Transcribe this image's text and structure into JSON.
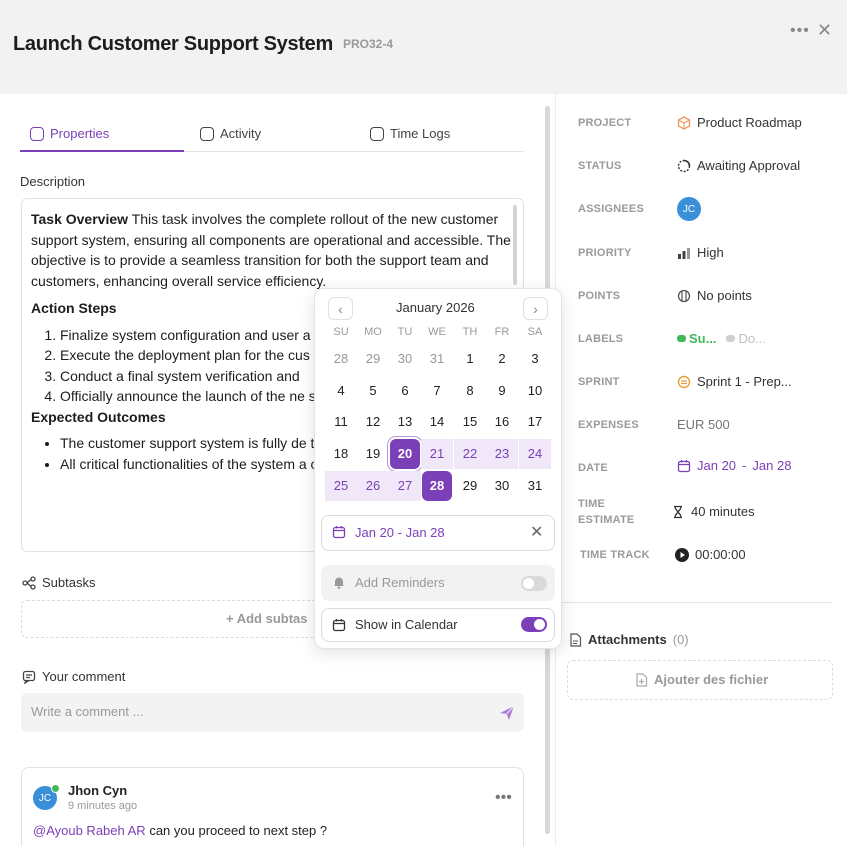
{
  "header": {
    "title": "Launch Customer Support System",
    "code": "PRO32-4",
    "more_icon": "ellipsis-icon",
    "close_icon": "close-icon"
  },
  "tabs": [
    {
      "label": "Properties",
      "active": true
    },
    {
      "label": "Activity",
      "active": false
    },
    {
      "label": "Time Logs",
      "active": false
    }
  ],
  "description": {
    "label": "Description",
    "overview_title": "Task Overview",
    "overview_text": " This task involves the complete rollout of the new customer support system, ensuring all components are operational and accessible. The objective is to provide a seamless transition for both the support team and customers, enhancing overall service efficiency.",
    "action_steps_title": "Action Steps",
    "action_steps": [
      "Finalize system configuration and user a",
      "Execute the deployment plan for the cus",
      "Conduct a final system verification and",
      "Officially announce the launch of the ne stakeholders."
    ],
    "outcomes_title": "Expected Outcomes",
    "outcomes": [
      "The customer support system is fully de to users.",
      "All critical functionalities of the system a operational"
    ]
  },
  "subtasks": {
    "label": "Subtasks",
    "add_label": "+ Add subtas"
  },
  "comment": {
    "label": "Your comment",
    "placeholder": "Write a comment ..."
  },
  "comments": [
    {
      "author": "Jhon Cyn",
      "initials": "JC",
      "time": "9 minutes ago",
      "mention": "@Ayoub Rabeh AR",
      "text": " can you proceed to next step ?"
    }
  ],
  "properties": {
    "project": {
      "label": "PROJECT",
      "value": "Product Roadmap"
    },
    "status": {
      "label": "STATUS",
      "value": "Awaiting Approval"
    },
    "assignees": {
      "label": "ASSIGNEES",
      "initials": "JC"
    },
    "priority": {
      "label": "PRIORITY",
      "value": "High"
    },
    "points": {
      "label": "POINTS",
      "value": "No points"
    },
    "labels": {
      "label": "LABELS",
      "items": [
        "Su...",
        "Do..."
      ],
      "colors": [
        "#43b75a",
        "#c8c8c8"
      ]
    },
    "sprint": {
      "label": "SPRINT",
      "value": "Sprint 1 - Prep..."
    },
    "expenses": {
      "label": "EXPENSES",
      "value": "EUR 500"
    },
    "date": {
      "label": "DATE",
      "start": "Jan 20",
      "sep": "-",
      "end": "Jan 28"
    },
    "time_estimate": {
      "label": "TIME ESTIMATE",
      "value": "40 minutes"
    },
    "time_track": {
      "label": "TIME TRACK",
      "value": "00:00:00"
    }
  },
  "attachments": {
    "label": "Attachments",
    "count": "(0)",
    "add_label": "Ajouter des fichier"
  },
  "calendar": {
    "month": "January 2026",
    "weekdays": [
      "SU",
      "MO",
      "TU",
      "WE",
      "TH",
      "FR",
      "SA"
    ],
    "weeks": [
      [
        "28",
        "29",
        "30",
        "31",
        "1",
        "2",
        "3"
      ],
      [
        "4",
        "5",
        "6",
        "7",
        "8",
        "9",
        "10"
      ],
      [
        "11",
        "12",
        "13",
        "14",
        "15",
        "16",
        "17"
      ],
      [
        "18",
        "19",
        "20",
        "21",
        "22",
        "23",
        "24"
      ],
      [
        "25",
        "26",
        "27",
        "28",
        "29",
        "30",
        "31"
      ]
    ],
    "range_start": "20",
    "range_end": "28",
    "range_text": "Jan 20 - Jan 28",
    "reminders_label": "Add Reminders",
    "reminders_on": false,
    "show_calendar_label": "Show in Calendar",
    "show_calendar_on": true
  },
  "colors": {
    "accent": "#7b3fb8",
    "range_bg": "#f0e7f9",
    "avatar": "#3a8fd9",
    "online": "#43b75a"
  }
}
